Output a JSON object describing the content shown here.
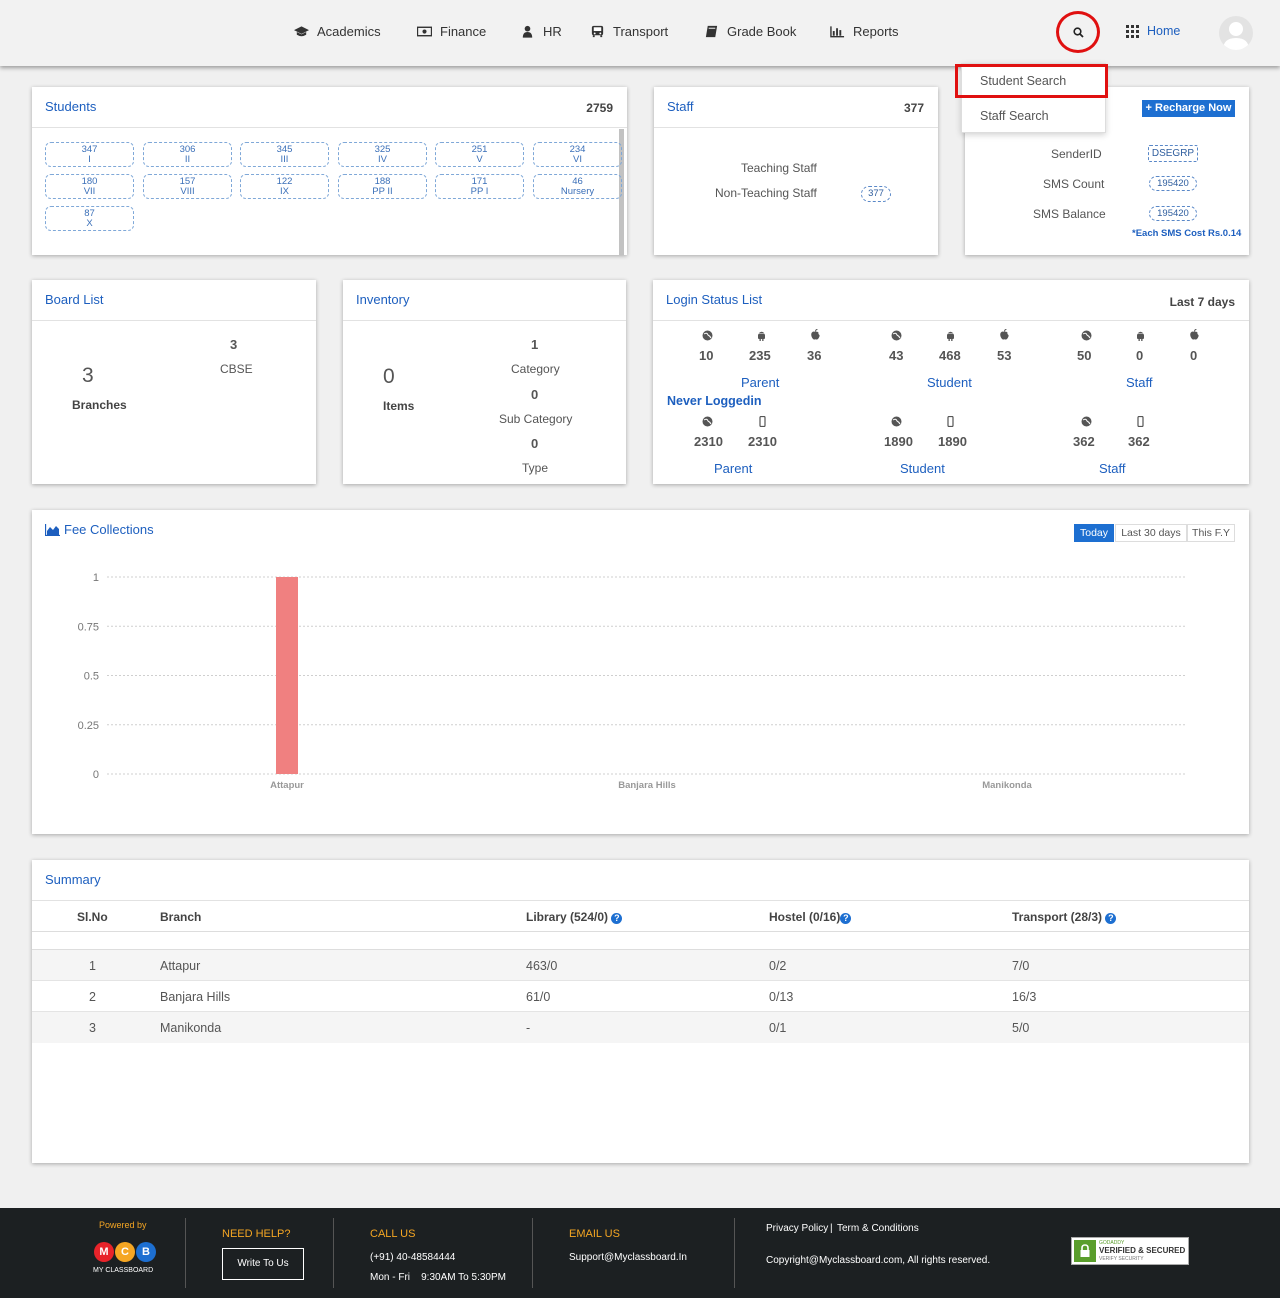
{
  "nav": {
    "items": [
      {
        "label": "Academics",
        "icon": "graduation-cap-icon"
      },
      {
        "label": "Finance",
        "icon": "money-icon"
      },
      {
        "label": "HR",
        "icon": "user-icon"
      },
      {
        "label": "Transport",
        "icon": "bus-icon"
      },
      {
        "label": "Grade Book",
        "icon": "book-icon"
      },
      {
        "label": "Reports",
        "icon": "bar-chart-icon"
      }
    ],
    "home_label": "Home"
  },
  "search_menu": {
    "items": [
      "Student Search",
      "Staff Search"
    ]
  },
  "students": {
    "title": "Students",
    "count": "2759",
    "classes": [
      {
        "count": "347",
        "name": "I"
      },
      {
        "count": "306",
        "name": "II"
      },
      {
        "count": "345",
        "name": "III"
      },
      {
        "count": "325",
        "name": "IV"
      },
      {
        "count": "251",
        "name": "V"
      },
      {
        "count": "234",
        "name": "VI"
      },
      {
        "count": "180",
        "name": "VII"
      },
      {
        "count": "157",
        "name": "VIII"
      },
      {
        "count": "122",
        "name": "IX"
      },
      {
        "count": "188",
        "name": "PP II"
      },
      {
        "count": "171",
        "name": "PP I"
      },
      {
        "count": "46",
        "name": "Nursery"
      },
      {
        "count": "87",
        "name": "X"
      }
    ]
  },
  "staff": {
    "title": "Staff",
    "count": "377",
    "teaching_label": "Teaching Staff",
    "non_teaching_label": "Non-Teaching Staff",
    "non_teaching_count": "377"
  },
  "sms": {
    "recharge_label": "Recharge Now",
    "sender_label": "SenderID",
    "sender_value": "DSEGRP",
    "count_label": "SMS Count",
    "count_value": "195420",
    "balance_label": "SMS Balance",
    "balance_value": "195420",
    "cost_note": "*Each SMS Cost Rs.0.14"
  },
  "board": {
    "title": "Board List",
    "branches_count": "3",
    "branches_label": "Branches",
    "board_count": "3",
    "board_name": "CBSE"
  },
  "inventory": {
    "title": "Inventory",
    "items_count": "0",
    "items_label": "Items",
    "category_count": "1",
    "category_label": "Category",
    "subcategory_count": "0",
    "subcategory_label": "Sub Category",
    "type_count": "0",
    "type_label": "Type"
  },
  "login_status": {
    "title": "Login Status List",
    "period": "Last 7 days",
    "groups": [
      {
        "label": "Parent",
        "web": "10",
        "android": "235",
        "ios": "36"
      },
      {
        "label": "Student",
        "web": "43",
        "android": "468",
        "ios": "53"
      },
      {
        "label": "Staff",
        "web": "50",
        "android": "0",
        "ios": "0"
      }
    ],
    "never_label": "Never Loggedin",
    "never_groups": [
      {
        "label": "Parent",
        "web": "2310",
        "mobile": "2310"
      },
      {
        "label": "Student",
        "web": "1890",
        "mobile": "1890"
      },
      {
        "label": "Staff",
        "web": "362",
        "mobile": "362"
      }
    ]
  },
  "fee": {
    "title": "Fee Collections",
    "tabs": [
      "Today",
      "Last 30 days",
      "This F.Y"
    ],
    "active_tab": "Today"
  },
  "chart_data": {
    "type": "bar",
    "categories": [
      "Attapur",
      "Banjara Hills",
      "Manikonda"
    ],
    "values": [
      1,
      0,
      0
    ],
    "title": "Fee Collections",
    "xlabel": "",
    "ylabel": "",
    "ylim": [
      0,
      1
    ],
    "yticks": [
      "1",
      "0.75",
      "0.5",
      "0.25",
      "0"
    ],
    "grid": true,
    "bar_color": "#f08080"
  },
  "summary": {
    "title": "Summary",
    "headers": [
      "Sl.No",
      "Branch",
      "Library (524/0)",
      "Hostel (0/16)",
      "Transport (28/3)"
    ],
    "rows": [
      [
        "1",
        "Attapur",
        "463/0",
        "0/2",
        "7/0"
      ],
      [
        "2",
        "Banjara Hills",
        "61/0",
        "0/13",
        "16/3"
      ],
      [
        "3",
        "Manikonda",
        "-",
        "0/1",
        "5/0"
      ]
    ]
  },
  "footer": {
    "powered_by": "Powered by",
    "brand": "MY CLASSBOARD",
    "logo_letters": [
      "M",
      "C",
      "B"
    ],
    "help_title": "NEED HELP?",
    "write_label": "Write To Us",
    "call_title": "CALL US",
    "phone": "(+91) 40-48584444",
    "hours": "Mon - Fri    9:30AM To 5:30PM",
    "email_title": "EMAIL US",
    "email": "Support@Myclassboard.In",
    "privacy": "Privacy Policy",
    "terms": "Term & Conditions",
    "copyright": "Copyright@Myclassboard.com, All rights reserved.",
    "badge_top": "GODADDY",
    "badge_main": "VERIFIED & SECURED",
    "badge_sub": "VERIFY SECURITY"
  },
  "colors": {
    "accent": "#1d5fbf",
    "highlight": "#e01010",
    "bar": "#f08080",
    "footer_bg": "#1c2022",
    "footer_heading": "#f5a623"
  }
}
